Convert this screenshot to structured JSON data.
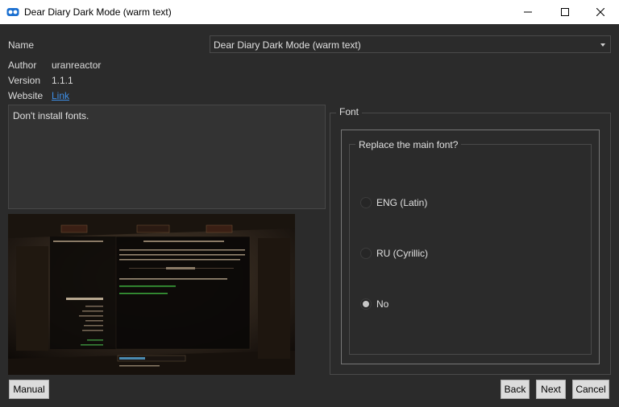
{
  "window": {
    "title": "Dear Diary Dark Mode (warm text)",
    "controls": [
      "minimize",
      "maximize",
      "close"
    ]
  },
  "info": {
    "name_label": "Name",
    "name_value": "Dear Diary Dark Mode (warm text)",
    "author_label": "Author",
    "author_value": "uranreactor",
    "version_label": "Version",
    "version_value": "1.1.1",
    "website_label": "Website",
    "website_link": "Link"
  },
  "description": "Don't install fonts.",
  "font_group": {
    "title": "Font",
    "question": "Replace the main font?",
    "options": [
      {
        "label": "ENG (Latin)",
        "selected": false
      },
      {
        "label": "RU (Cyrillic)",
        "selected": false
      },
      {
        "label": "No",
        "selected": true
      }
    ]
  },
  "buttons": {
    "manual": "Manual",
    "back": "Back",
    "next": "Next",
    "cancel": "Cancel"
  },
  "colors": {
    "background": "#2b2b2b",
    "link": "#3e8fe8",
    "button": "#dcdcdc"
  }
}
